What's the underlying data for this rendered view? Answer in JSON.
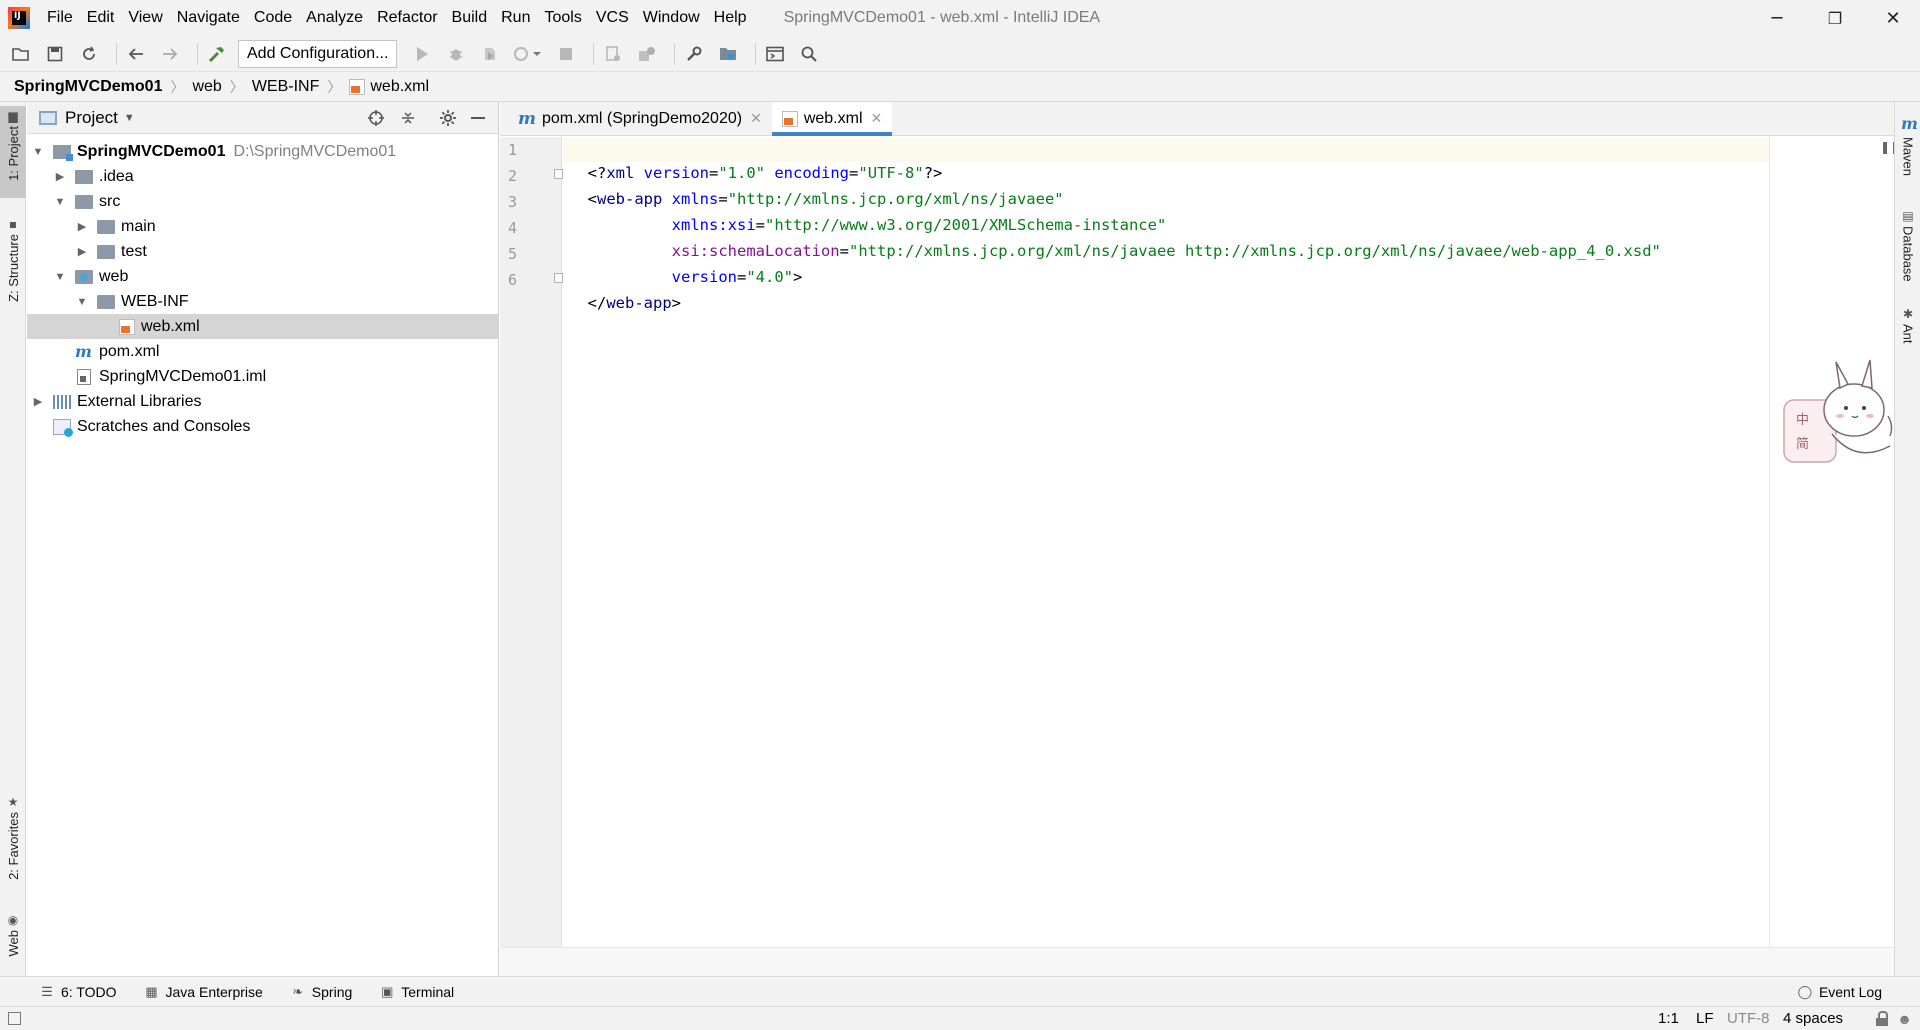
{
  "menu": {
    "items": [
      "File",
      "Edit",
      "View",
      "Navigate",
      "Code",
      "Analyze",
      "Refactor",
      "Build",
      "Run",
      "Tools",
      "VCS",
      "Window",
      "Help"
    ],
    "underline": [
      "F",
      "E",
      "V",
      "N",
      "C",
      "",
      "R",
      "B",
      "u",
      "T",
      "S",
      "W",
      "H"
    ]
  },
  "window": {
    "title": "SpringMVCDemo01 - web.xml - IntelliJ IDEA",
    "minimize": "─",
    "restore": "❐",
    "close": "✕"
  },
  "toolbar": {
    "add_configuration": "Add Configuration..."
  },
  "breadcrumbs": [
    "SpringMVCDemo01",
    "web",
    "WEB-INF",
    "web.xml"
  ],
  "left_strip": {
    "project_tab": "1: Project",
    "structure_tab": "Z: Structure",
    "favorites_tab": "2: Favorites",
    "web_tab": "Web"
  },
  "right_strip": {
    "maven_tab": "Maven",
    "database_tab": "Database",
    "ant_tab": "Ant"
  },
  "project_panel": {
    "title": "Project",
    "tree": [
      {
        "label": "SpringMVCDemo01",
        "path": "D:\\SpringMVCDemo01",
        "type": "module",
        "expanded": true,
        "depth": 0
      },
      {
        "label": ".idea",
        "type": "folder",
        "expanded": false,
        "depth": 1
      },
      {
        "label": "src",
        "type": "folder",
        "expanded": true,
        "depth": 1
      },
      {
        "label": "main",
        "type": "folder",
        "expanded": false,
        "depth": 2
      },
      {
        "label": "test",
        "type": "folder",
        "expanded": false,
        "depth": 2
      },
      {
        "label": "web",
        "type": "web-folder",
        "expanded": true,
        "depth": 1
      },
      {
        "label": "WEB-INF",
        "type": "folder",
        "expanded": true,
        "depth": 2
      },
      {
        "label": "web.xml",
        "type": "xml",
        "depth": 3,
        "selected": true
      },
      {
        "label": "pom.xml",
        "type": "maven",
        "depth": 1
      },
      {
        "label": "SpringMVCDemo01.iml",
        "type": "iml",
        "depth": 1
      },
      {
        "label": "External Libraries",
        "type": "library",
        "expanded": false,
        "depth": 0
      },
      {
        "label": "Scratches and Consoles",
        "type": "scratch",
        "depth": 0
      }
    ]
  },
  "editor": {
    "tabs": [
      {
        "label": "pom.xml (SpringDemo2020)",
        "active": false
      },
      {
        "label": "web.xml",
        "active": true
      }
    ],
    "line_numbers": [
      "1",
      "2",
      "3",
      "4",
      "5",
      "6"
    ],
    "code": {
      "l1": {
        "open": "<?",
        "tag": "xml",
        "a1": " version",
        "eq1": "=",
        "v1": "\"1.0\"",
        "a2": " encoding",
        "eq2": "=",
        "v2": "\"UTF-8\"",
        "close": "?>"
      },
      "l2": {
        "open": "<",
        "tag": "web-app",
        "a1": " xmlns",
        "eq1": "=",
        "v1": "\"http://xmlns.jcp.org/xml/ns/javaee\""
      },
      "l3": {
        "indent": "         ",
        "ns": "xmlns:xsi",
        "eq1": "=",
        "v1": "\"http://www.w3.org/2001/XMLSchema-instance\""
      },
      "l4": {
        "indent": "         ",
        "ns": "xsi:schemaLocation",
        "eq1": "=",
        "v1": "\"http://xmlns.jcp.org/xml/ns/javaee http://xmlns.jcp.org/xml/ns/javaee/web-app_4_0.xsd\""
      },
      "l5": {
        "indent": "         ",
        "a1": "version",
        "eq1": "=",
        "v1": "\"4.0\"",
        "close": ">"
      },
      "l6": {
        "open": "</",
        "tag": "web-app",
        "close": ">"
      }
    }
  },
  "bottom_tools": {
    "todo": "6: TODO",
    "java_enterprise": "Java Enterprise",
    "spring": "Spring",
    "terminal": "Terminal",
    "event_log": "Event Log"
  },
  "status": {
    "position": "1:1",
    "line_separator": "LF",
    "encoding": "UTF-8",
    "indent": "4 spaces"
  },
  "icons": [
    "folder-open-icon",
    "save-icon",
    "sync-icon",
    "back-icon",
    "forward-icon",
    "build-hammer-icon",
    "run-icon",
    "debug-icon",
    "coverage-icon",
    "profile-icon",
    "stop-icon",
    "settings-wrench-icon",
    "project-structure-icon",
    "search-icon",
    "locate-icon",
    "collapse-icon",
    "gear-icon",
    "minimize-panel-icon",
    "lock-icon"
  ],
  "colors": {
    "xml_tag": "#000080",
    "xml_attr": "#0000ff",
    "xml_string": "#067d17",
    "xml_namespace": "#871094",
    "active_tab_underline": "#4083c9",
    "selection": "#d5d5d5"
  }
}
